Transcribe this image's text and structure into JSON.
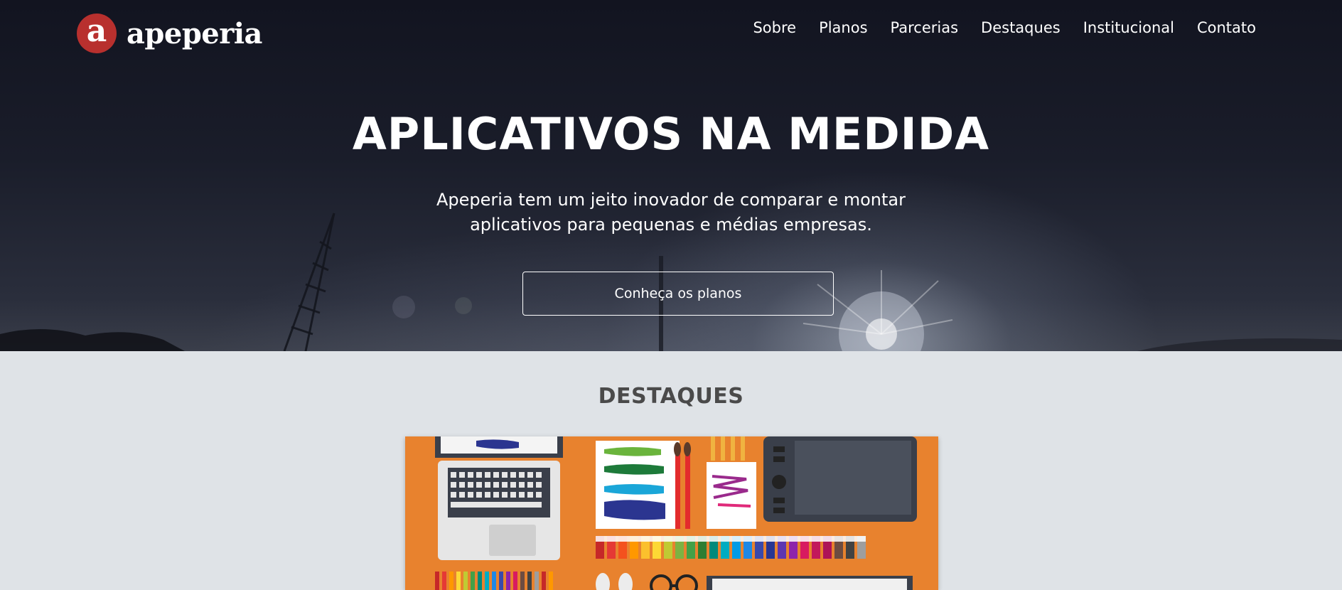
{
  "brand": {
    "logo_letter": "a",
    "name": "apeperia",
    "accent_color": "#b8302e"
  },
  "nav": {
    "items": [
      {
        "label": "Sobre"
      },
      {
        "label": "Planos"
      },
      {
        "label": "Parcerias"
      },
      {
        "label": "Destaques"
      },
      {
        "label": "Institucional"
      },
      {
        "label": "Contato"
      }
    ]
  },
  "hero": {
    "title": "APLICATIVOS NA MEDIDA",
    "subtitle_line1": "Apeperia tem um jeito inovador de comparar e montar",
    "subtitle_line2": "aplicativos para pequenas e médias empresas.",
    "cta_label": "Conheça os planos"
  },
  "destaques": {
    "title": "DESTAQUES",
    "card_background": "#e8822e"
  }
}
